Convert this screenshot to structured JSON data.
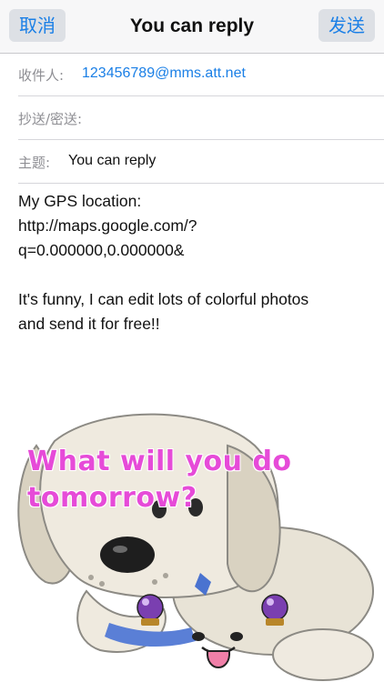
{
  "navbar": {
    "cancel_label": "取消",
    "title": "You can reply",
    "send_label": "发送"
  },
  "fields": {
    "to_label": "收件人:",
    "to_value": "123456789@mms.att.net",
    "cc_label": "抄送/密送:",
    "subject_label": "主题:",
    "subject_value": "You can reply"
  },
  "body": {
    "lines": [
      "My GPS location:",
      "http://maps.google.com/?",
      "q=0.000000,0.000000&",
      "It's funny, I can edit lots of colorful photos",
      "and send it for free!!"
    ]
  },
  "photo": {
    "caption": "What will you do tomorrow?",
    "caption_color": "#e64bd8"
  },
  "colors": {
    "accent": "#1a7fe6",
    "navbar_bg": "#f7f7f8"
  }
}
